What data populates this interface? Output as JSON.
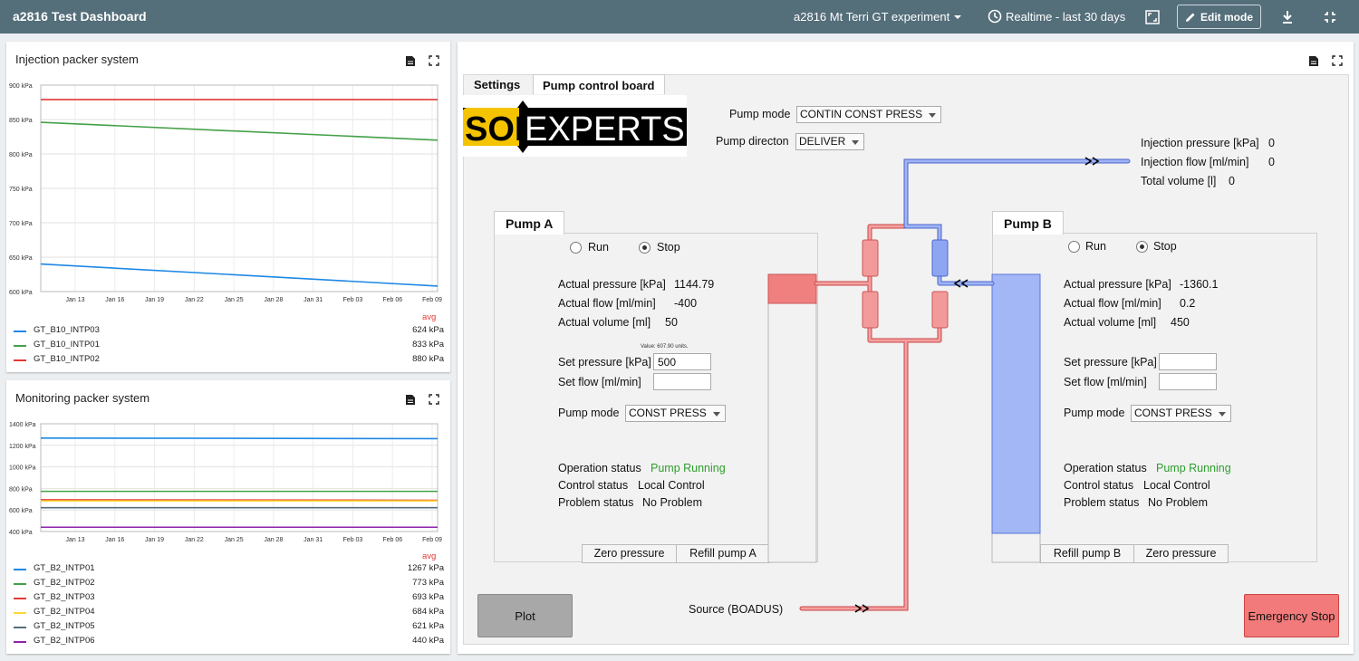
{
  "app": {
    "title": "a2816 Test Dashboard",
    "dashboard_name": "a2816 Mt Terri GT experiment",
    "time_range": "Realtime - last 30 days",
    "edit_mode_label": "Edit mode"
  },
  "injection_card": {
    "title": "Injection packer system",
    "chart_data": {
      "type": "line",
      "title": "Injection packer system",
      "y_tick_labels": [
        "900 kPa",
        "850 kPa",
        "800 kPa",
        "750 kPa",
        "700 kPa",
        "650 kPa",
        "600 kPa"
      ],
      "x_tick_labels": [
        "Jan 13",
        "Jan 16",
        "Jan 19",
        "Jan 22",
        "Jan 25",
        "Jan 28",
        "Jan 31",
        "Feb 03",
        "Feb 06",
        "Feb 09"
      ],
      "ylim": [
        600,
        900
      ],
      "grid": true,
      "series": [
        {
          "name": "GT_B10_INTP03",
          "color": "#1e88e5",
          "start": 640,
          "end": 608
        },
        {
          "name": "GT_B10_INTP01",
          "color": "#43a047",
          "start": 846,
          "end": 820
        },
        {
          "name": "GT_B10_INTP02",
          "color": "#e53935",
          "start": 879,
          "end": 879
        }
      ]
    },
    "legend_header": "avg",
    "legend": [
      {
        "name": "GT_B10_INTP03",
        "value": "624 kPa",
        "color": "#1e88e5"
      },
      {
        "name": "GT_B10_INTP01",
        "value": "833 kPa",
        "color": "#43a047"
      },
      {
        "name": "GT_B10_INTP02",
        "value": "880 kPa",
        "color": "#e53935"
      }
    ]
  },
  "monitoring_card": {
    "title": "Monitoring packer system",
    "chart_data": {
      "type": "line",
      "title": "Monitoring packer system",
      "y_tick_labels": [
        "1400 kPa",
        "1200 kPa",
        "1000 kPa",
        "800 kPa",
        "600 kPa",
        "400 kPa"
      ],
      "x_tick_labels": [
        "Jan 13",
        "Jan 16",
        "Jan 19",
        "Jan 22",
        "Jan 25",
        "Jan 28",
        "Jan 31",
        "Feb 03",
        "Feb 06",
        "Feb 09"
      ],
      "ylim": [
        400,
        1400
      ],
      "grid": true,
      "series": [
        {
          "name": "GT_B2_INTP01",
          "color": "#1e88e5",
          "start": 1267,
          "end": 1262
        },
        {
          "name": "GT_B2_INTP02",
          "color": "#43a047",
          "start": 773,
          "end": 773
        },
        {
          "name": "GT_B2_INTP03",
          "color": "#e53935",
          "start": 695,
          "end": 690
        },
        {
          "name": "GT_B2_INTP04",
          "color": "#fdd835",
          "start": 684,
          "end": 684
        },
        {
          "name": "GT_B2_INTP05",
          "color": "#546e7a",
          "start": 621,
          "end": 621
        },
        {
          "name": "GT_B2_INTP06",
          "color": "#8e24aa",
          "start": 440,
          "end": 440
        }
      ]
    },
    "legend_header": "avg",
    "legend": [
      {
        "name": "GT_B2_INTP01",
        "value": "1267 kPa",
        "color": "#1e88e5"
      },
      {
        "name": "GT_B2_INTP02",
        "value": "773 kPa",
        "color": "#43a047"
      },
      {
        "name": "GT_B2_INTP03",
        "value": "693 kPa",
        "color": "#e53935"
      },
      {
        "name": "GT_B2_INTP04",
        "value": "684 kPa",
        "color": "#fdd835"
      },
      {
        "name": "GT_B2_INTP05",
        "value": "621 kPa",
        "color": "#546e7a"
      },
      {
        "name": "GT_B2_INTP06",
        "value": "440 kPa",
        "color": "#8e24aa"
      }
    ]
  },
  "control": {
    "tabs": [
      "Settings",
      "Pump control board"
    ],
    "logo_text": "SOLEXPERTS",
    "pump_mode_label": "Pump mode",
    "pump_mode_value": "CONTIN CONST PRESS",
    "pump_direction_label": "Pump directon",
    "pump_direction_value": "DELIVER",
    "injection_pressure_label": "Injection pressure [kPa]",
    "injection_pressure_value": "0",
    "injection_flow_label": "Injection flow [ml/min]",
    "injection_flow_value": "0",
    "total_volume_label": "Total volume [l]",
    "total_volume_value": "0",
    "source_label": "Source (BOADUS)",
    "plot_label": "Plot",
    "emergency_label": "Emergency Stop",
    "pump_a": {
      "title": "Pump A",
      "run": "Run",
      "stop": "Stop",
      "actual_pressure_label": "Actual pressure [kPa]",
      "actual_pressure": "1144.79",
      "actual_flow_label": "Actual flow [ml/min]",
      "actual_flow": "-400",
      "actual_volume_label": "Actual volume [ml]",
      "actual_volume": "50",
      "value_note": "Value: 607.90 units.",
      "set_pressure_label": "Set pressure [kPa]",
      "set_pressure": "500",
      "set_flow_label": "Set flow [ml/min]",
      "set_flow": "",
      "pump_mode_label": "Pump mode",
      "pump_mode": "CONST PRESS",
      "operation_status_label": "Operation status",
      "operation_status": "Pump Running",
      "control_status_label": "Control status",
      "control_status": "Local Control",
      "problem_status_label": "Problem status",
      "problem_status": "No Problem",
      "zero_pressure": "Zero pressure",
      "refill": "Refill pump A",
      "level_fraction": 0.1
    },
    "pump_b": {
      "title": "Pump B",
      "run": "Run",
      "stop": "Stop",
      "actual_pressure_label": "Actual pressure [kPa]",
      "actual_pressure": "-1360.1",
      "actual_flow_label": "Actual flow [ml/min]",
      "actual_flow": "0.2",
      "actual_volume_label": "Actual volume [ml]",
      "actual_volume": "450",
      "set_pressure_label": "Set pressure [kPa]",
      "set_pressure": "",
      "set_flow_label": "Set flow [ml/min]",
      "set_flow": "",
      "pump_mode_label": "Pump mode",
      "pump_mode": "CONST PRESS",
      "operation_status_label": "Operation status",
      "operation_status": "Pump Running",
      "control_status_label": "Control status",
      "control_status": "Local Control",
      "problem_status_label": "Problem status",
      "problem_status": "No Problem",
      "refill": "Refill pump B",
      "zero_pressure": "Zero pressure",
      "level_fraction": 0.9
    }
  },
  "colors": {
    "topbar": "#546e7a",
    "pipe_red": "#f08080",
    "pipe_blue": "#7b96f0",
    "status_green": "#2e9e2e",
    "emergency": "#f27a7a"
  }
}
